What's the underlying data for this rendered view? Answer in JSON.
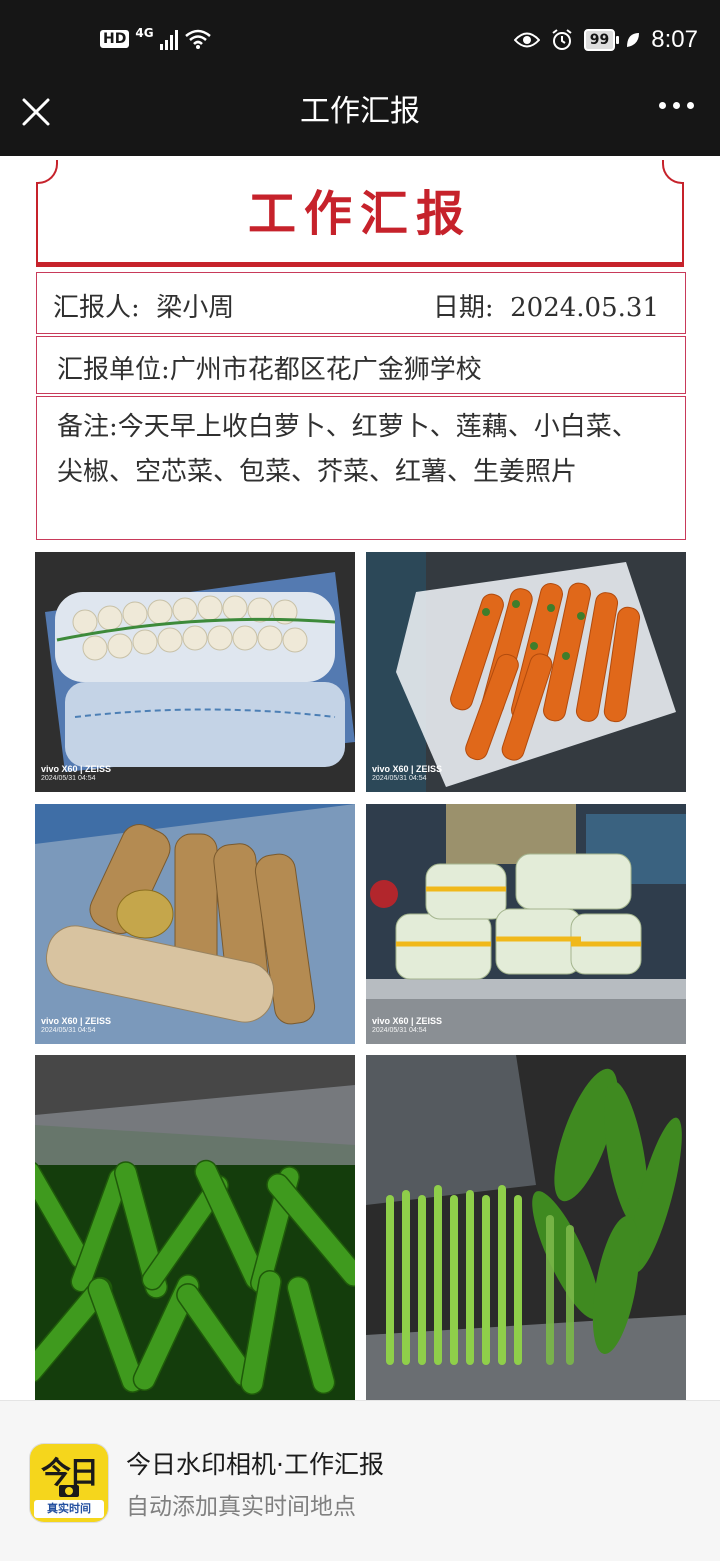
{
  "status_bar": {
    "hd": "HD",
    "network": "4G",
    "battery": "99",
    "time": "8:07"
  },
  "nav": {
    "title": "工作汇报"
  },
  "report": {
    "title": "工作汇报",
    "reporter_label": "汇报人:",
    "reporter_name": "梁小周",
    "date_label": "日期:",
    "date_value": "2024.05.31",
    "unit": "汇报单位:广州市花都区花广金狮学校",
    "notes": "备注:今天早上收白萝卜、红萝卜、莲藕、小白菜、尖椒、空芯菜、包菜、芥菜、红薯、生姜照片"
  },
  "photos": [
    {
      "watermark": "vivo X60 | ZEISS",
      "date": "2024/05/31 04:54"
    },
    {
      "watermark": "vivo X60 | ZEISS",
      "date": "2024/05/31 04:54"
    },
    {
      "watermark": "vivo X60 | ZEISS",
      "date": "2024/05/31 04:54"
    },
    {
      "watermark": "vivo X60 | ZEISS",
      "date": "2024/05/31 04:54"
    }
  ],
  "app_card": {
    "logo_text_top": "今日",
    "logo_text_bottom": "真实时间",
    "name": "今日水印相机·工作汇报",
    "description": "自动添加真实时间地点"
  },
  "colors": {
    "accent_red": "#c6222b",
    "border_pink": "#c83a5a",
    "logo_yellow": "#f5d61c",
    "status_bar_bg": "#161616"
  }
}
